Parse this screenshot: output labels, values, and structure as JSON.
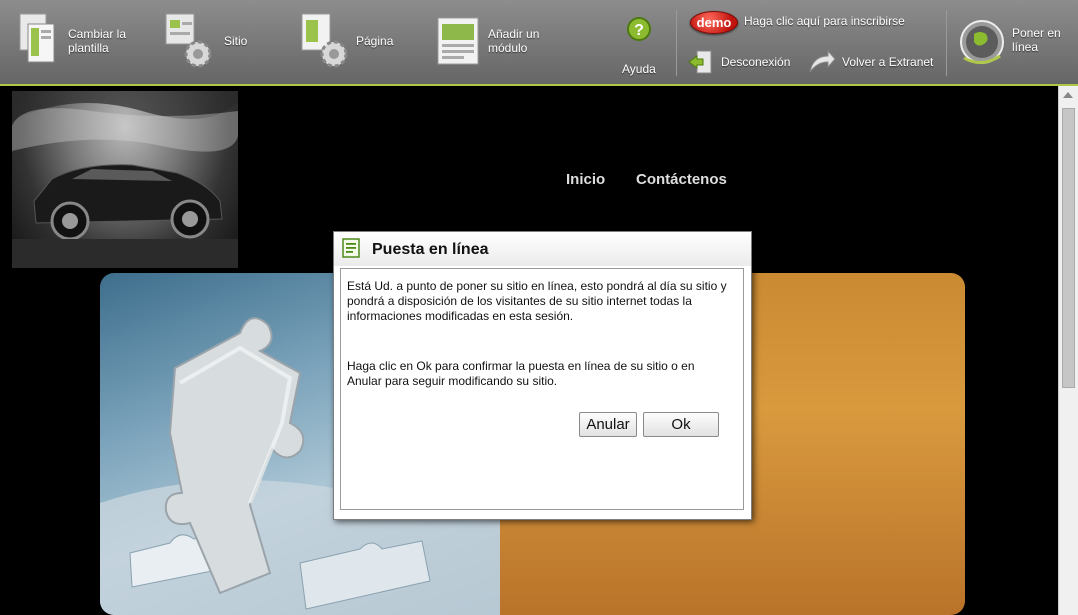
{
  "toolbar": {
    "change_template": "Cambiar la\nplantilla",
    "site": "Sitio",
    "page": "Página",
    "add_module": "Añadir un\nmódulo",
    "help": "Ayuda",
    "demo_badge": "demo",
    "signup": "Haga clic aquí para inscribirse",
    "logout": "Desconexión",
    "extranet": "Volver a Extranet",
    "publish": "Poner en\nlínea"
  },
  "nav": {
    "home": "Inicio",
    "contact": "Contáctenos"
  },
  "dialog": {
    "title": "Puesta en línea",
    "message1": "Está Ud. a punto de poner su sitio en línea, esto pondrá al día su sitio y pondrá a disposición de los visitantes de su sitio internet todas la informaciones modificadas en esta sesión.",
    "message2": "Haga clic en Ok para confirmar la puesta en línea de su sitio o en Anular para seguir modificando su sitio.",
    "cancel": "Anular",
    "ok": "Ok"
  },
  "colors": {
    "toolbar_accent": "#b0c84a",
    "banner_orange": "#d99a3e",
    "demo_red": "#c0140e"
  },
  "icons": {
    "template": "template-icon",
    "site": "site-gear-icon",
    "page": "page-gear-icon",
    "module": "module-icon",
    "help": "help-icon",
    "logout": "logout-icon",
    "extranet": "return-arrow-icon",
    "publish": "globe-icon",
    "dialog": "document-icon"
  }
}
